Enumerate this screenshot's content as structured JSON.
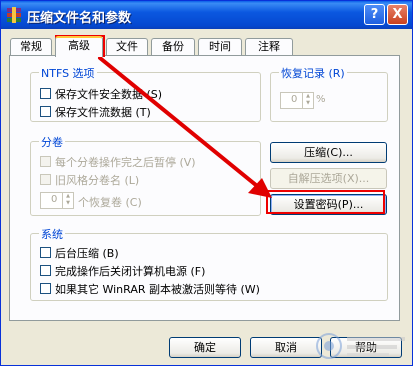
{
  "window": {
    "title": "压缩文件名和参数"
  },
  "tabs": [
    {
      "label": "常规"
    },
    {
      "label": "高级"
    },
    {
      "label": "文件"
    },
    {
      "label": "备份"
    },
    {
      "label": "时间"
    },
    {
      "label": "注释"
    }
  ],
  "ntfs": {
    "title": "NTFS 选项",
    "save_security": "保存文件安全数据 (S)",
    "save_streams": "保存文件流数据 (T)"
  },
  "recovery": {
    "title": "恢复记录 (R)",
    "value": "0",
    "unit": "%"
  },
  "volumes": {
    "title": "分卷",
    "pause_each": "每个分卷操作完之后暂停 (V)",
    "old_naming": "旧风格分卷名 (L)",
    "recovery_value": "0",
    "recovery_label": "个恢复卷 (C)"
  },
  "buttons": {
    "compression": "压缩(C)...",
    "sfx_options": "自解压选项(X)...",
    "set_password": "设置密码(P)...",
    "ok": "确定",
    "cancel": "取消",
    "help": "帮助"
  },
  "system": {
    "title": "系统",
    "background": "后台压缩 (B)",
    "shutdown": "完成操作后关闭计算机电源 (F)",
    "wait_other": "如果其它 WinRAR 副本被激活则等待 (W)"
  },
  "title_buttons": {
    "help": "?",
    "close": "X"
  },
  "colors": {
    "annotation_red": "#e00000",
    "group_label": "#0046d5"
  }
}
